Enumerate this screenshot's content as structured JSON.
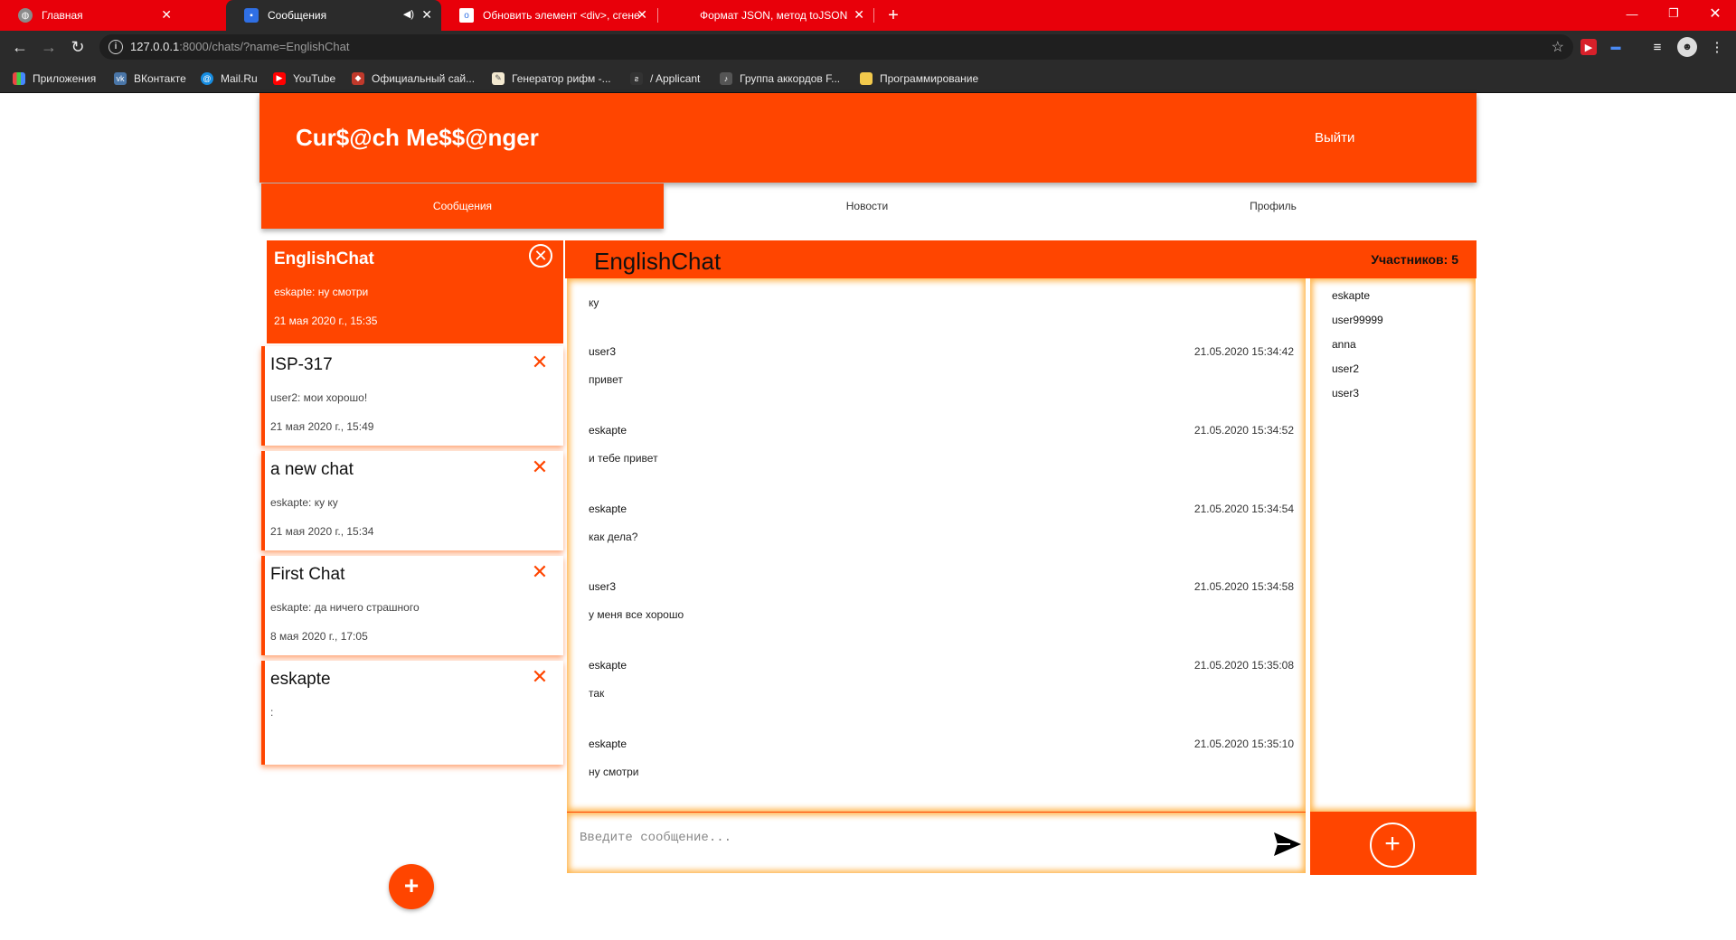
{
  "browser": {
    "tabs": [
      {
        "title": "Главная"
      },
      {
        "title": "Сообщения"
      },
      {
        "title": "Обновить элемент <div>, сгене"
      },
      {
        "title": "Формат JSON, метод toJSON"
      }
    ],
    "url_host": "127.0.0.1",
    "url_rest": ":8000/chats/?name=EnglishChat",
    "bookmarks": [
      {
        "label": "Приложения"
      },
      {
        "label": "ВКонтакте"
      },
      {
        "label": "Mail.Ru"
      },
      {
        "label": "YouTube"
      },
      {
        "label": "Официальный сай..."
      },
      {
        "label": "Генератор рифм -..."
      },
      {
        "label": "/ Applicant"
      },
      {
        "label": "Группа аккордов F..."
      },
      {
        "label": "Программирование"
      }
    ]
  },
  "header": {
    "logo": "Cur$@ch Me$$@nger",
    "logout": "Выйти"
  },
  "nav": {
    "tabs": [
      {
        "label": "Сообщения",
        "active": true
      },
      {
        "label": "Новости",
        "active": false
      },
      {
        "label": "Профиль",
        "active": false
      }
    ]
  },
  "chats": [
    {
      "name": "EnglishChat",
      "last": "eskapte: ну смотри",
      "date": "21 мая 2020 г., 15:35",
      "active": true
    },
    {
      "name": "ISP-317",
      "last": "user2: мои хорошо!",
      "date": "21 мая 2020 г., 15:49",
      "active": false
    },
    {
      "name": "a new chat",
      "last": "eskapte: ку ку",
      "date": "21 мая 2020 г., 15:34",
      "active": false
    },
    {
      "name": "First Chat",
      "last": "eskapte: да ничего страшного",
      "date": "8 мая 2020 г., 17:05",
      "active": false
    },
    {
      "name": "eskapte",
      "last": ":",
      "date": "",
      "active": false
    }
  ],
  "chat": {
    "title": "EnglishChat",
    "members_count": "Участников: 5",
    "messages": [
      {
        "author": "",
        "time": "",
        "text": "ку"
      },
      {
        "author": "user3",
        "time": "21.05.2020 15:34:42",
        "text": "привет"
      },
      {
        "author": "eskapte",
        "time": "21.05.2020 15:34:52",
        "text": "и тебе привет"
      },
      {
        "author": "eskapte",
        "time": "21.05.2020 15:34:54",
        "text": "как дела?"
      },
      {
        "author": "user3",
        "time": "21.05.2020 15:34:58",
        "text": "у меня все хорошо"
      },
      {
        "author": "eskapte",
        "time": "21.05.2020 15:35:08",
        "text": "так"
      },
      {
        "author": "eskapte",
        "time": "21.05.2020 15:35:10",
        "text": "ну смотри"
      }
    ],
    "members": [
      "eskapte",
      "user99999",
      "anna",
      "user2",
      "user3"
    ],
    "input_placeholder": "Введите сообщение...",
    "input_value": ""
  },
  "colors": {
    "accent": "#ff4500",
    "tabbar": "#e8000a",
    "chrome": "#2b2b2b"
  },
  "icons": {
    "send": "send-icon",
    "add": "plus-icon",
    "close": "close-icon"
  }
}
